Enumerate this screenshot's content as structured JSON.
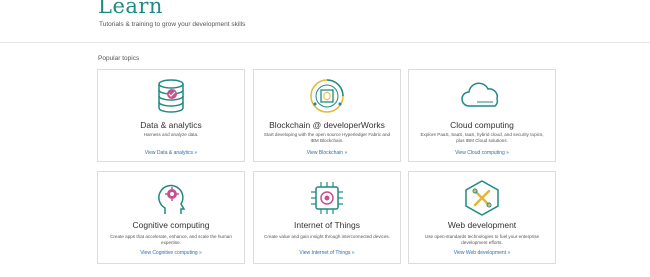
{
  "header": {
    "title": "Learn",
    "subtitle": "Tutorials & training to grow your development skills"
  },
  "section": {
    "label": "Popular topics"
  },
  "colors": {
    "accent": "#1f8a84",
    "link": "#2a6fb0",
    "icon_magenta": "#c94f8f",
    "icon_yellow": "#e0b83a"
  },
  "topics": [
    {
      "icon": "data-analytics-icon",
      "title": "Data & analytics",
      "description": "Harness and analyze data.",
      "link": "View Data & analytics »"
    },
    {
      "icon": "blockchain-icon",
      "title": "Blockchain @ developerWorks",
      "description": "Start developing with the open source Hyperledger Fabric and IBM Blockchain.",
      "link": "View Blockchain »"
    },
    {
      "icon": "cloud-icon",
      "title": "Cloud computing",
      "description": "Explore PaaS, SaaS, IaaS, hybrid cloud, and security topics, plus IBM Cloud solutions.",
      "link": "View Cloud computing »"
    },
    {
      "icon": "cognitive-icon",
      "title": "Cognitive computing",
      "description": "Create apps that accelerate, enhance, and scale the human expertise.",
      "link": "View Cognitive computing »"
    },
    {
      "icon": "iot-chip-icon",
      "title": "Internet of Things",
      "description": "Create value and gain insight through interconnected devices.",
      "link": "View Internet of Things »"
    },
    {
      "icon": "web-development-icon",
      "title": "Web development",
      "description": "Use open-standards technologies to fuel your enterprise development efforts.",
      "link": "View Web development »"
    }
  ]
}
